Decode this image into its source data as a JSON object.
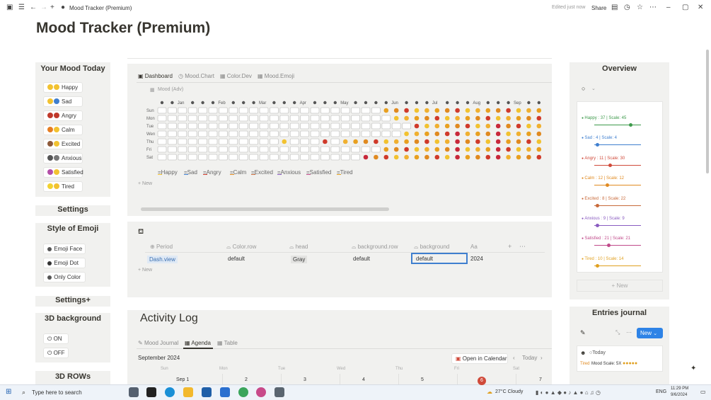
{
  "window": {
    "title": "Mood Tracker (Premium)",
    "status": "Edited just now",
    "share": "Share"
  },
  "page": {
    "title": "Mood Tracker (Premium)"
  },
  "left": {
    "mood_today_title": "Your Mood Today",
    "moods": [
      {
        "label": "Happy",
        "c1": "#f2c230",
        "c2": "#f2c230"
      },
      {
        "label": "Sad",
        "c1": "#f2c230",
        "c2": "#3f7fcf"
      },
      {
        "label": "Angry",
        "c1": "#c0392b",
        "c2": "#c0392b"
      },
      {
        "label": "Calm",
        "c1": "#e67e22",
        "c2": "#f2c230"
      },
      {
        "label": "Excited",
        "c1": "#8e5a3a",
        "c2": "#f2c230"
      },
      {
        "label": "Anxious",
        "c1": "#555555",
        "c2": "#777777"
      },
      {
        "label": "Satisfied",
        "c1": "#b34fa8",
        "c2": "#f2c230"
      },
      {
        "label": "Tired",
        "c1": "#f2d230",
        "c2": "#f2c230"
      }
    ],
    "settings_title": "Settings",
    "style_title": "Style of Emoji",
    "styles": [
      "Emoji Face",
      "Emoji Dot",
      "Only Color"
    ],
    "settings_plus_title": "Settings+",
    "bg3d_title": "3D background",
    "bg3d_options": [
      "ON",
      "OFF"
    ],
    "rows3d_title": "3D ROWs"
  },
  "dashboard": {
    "tabs": [
      "Dashboard",
      "Mood.Chart",
      "Color.Dev",
      "Mood.Emoji"
    ],
    "db_name": "Mood (Adv)",
    "months": [
      "Jan",
      "Feb",
      "Mar",
      "Apr",
      "May",
      "Jun",
      "Jul",
      "Aug",
      "Sep"
    ],
    "days": [
      "Sun",
      "Mon",
      "Tue",
      "Wen",
      "Thu",
      "Fri",
      "Sat"
    ],
    "legend": [
      "=Happy",
      "=Sad",
      "=Angry",
      "=Calm",
      "=Excited",
      "=Anxious",
      "=Satisfied",
      "=Tired"
    ],
    "new_label": "New"
  },
  "settings_table": {
    "columns": [
      "Period",
      "Color.row",
      "head",
      "background.row",
      "background",
      "Aa"
    ],
    "row": [
      "Dash.view",
      "default",
      "Gray",
      "default",
      "default",
      "2024"
    ],
    "new_label": "New"
  },
  "activity": {
    "title": "Activity Log",
    "tabs": [
      "Mood Journal",
      "Agenda",
      "Table"
    ],
    "month": "September 2024",
    "open_calendar": "Open in Calendar",
    "today": "Today",
    "weekdays": [
      "Sun",
      "Mon",
      "Tue",
      "Wed",
      "Thu",
      "Fri",
      "Sat"
    ],
    "dates": [
      "Sep 1",
      "2",
      "3",
      "4",
      "5",
      "6",
      "7"
    ]
  },
  "overview": {
    "title": "Overview",
    "items": [
      {
        "label": "Happy : 37 | Scale: 45",
        "color": "#3d9a4b",
        "level": 0.26
      },
      {
        "label": "Sad : 4 | Scale: 4",
        "color": "#3f7fcf",
        "level": 0.02
      },
      {
        "label": "Angry : 11 | Scale: 30",
        "color": "#d04a3a",
        "level": 0.11
      },
      {
        "label": "Calm : 12 | Scale: 12",
        "color": "#e08a20",
        "level": 0.09
      },
      {
        "label": "Excited : 8 | Scale: 22",
        "color": "#c86a3a",
        "level": 0.02
      },
      {
        "label": "Anxious : 9 | Scale: 9",
        "color": "#8a5cc0",
        "level": 0.02
      },
      {
        "label": "Satisfied : 21 | Scale: 21",
        "color": "#c04a8a",
        "level": 0.1
      },
      {
        "label": "Tired : 10 | Scale: 14",
        "color": "#e0a020",
        "level": 0.02
      }
    ],
    "new_label": "New"
  },
  "journal": {
    "title": "Entries journal",
    "new_button": "New",
    "entry_date": "Today",
    "entry_mood": "Tired",
    "entry_scale": "Mood Scale: 5X"
  },
  "taskbar": {
    "search": "Type here to search",
    "weather": "27°C  Cloudy",
    "lang": "ENG",
    "time": "11:29 PM",
    "date": "9/6/2024"
  }
}
